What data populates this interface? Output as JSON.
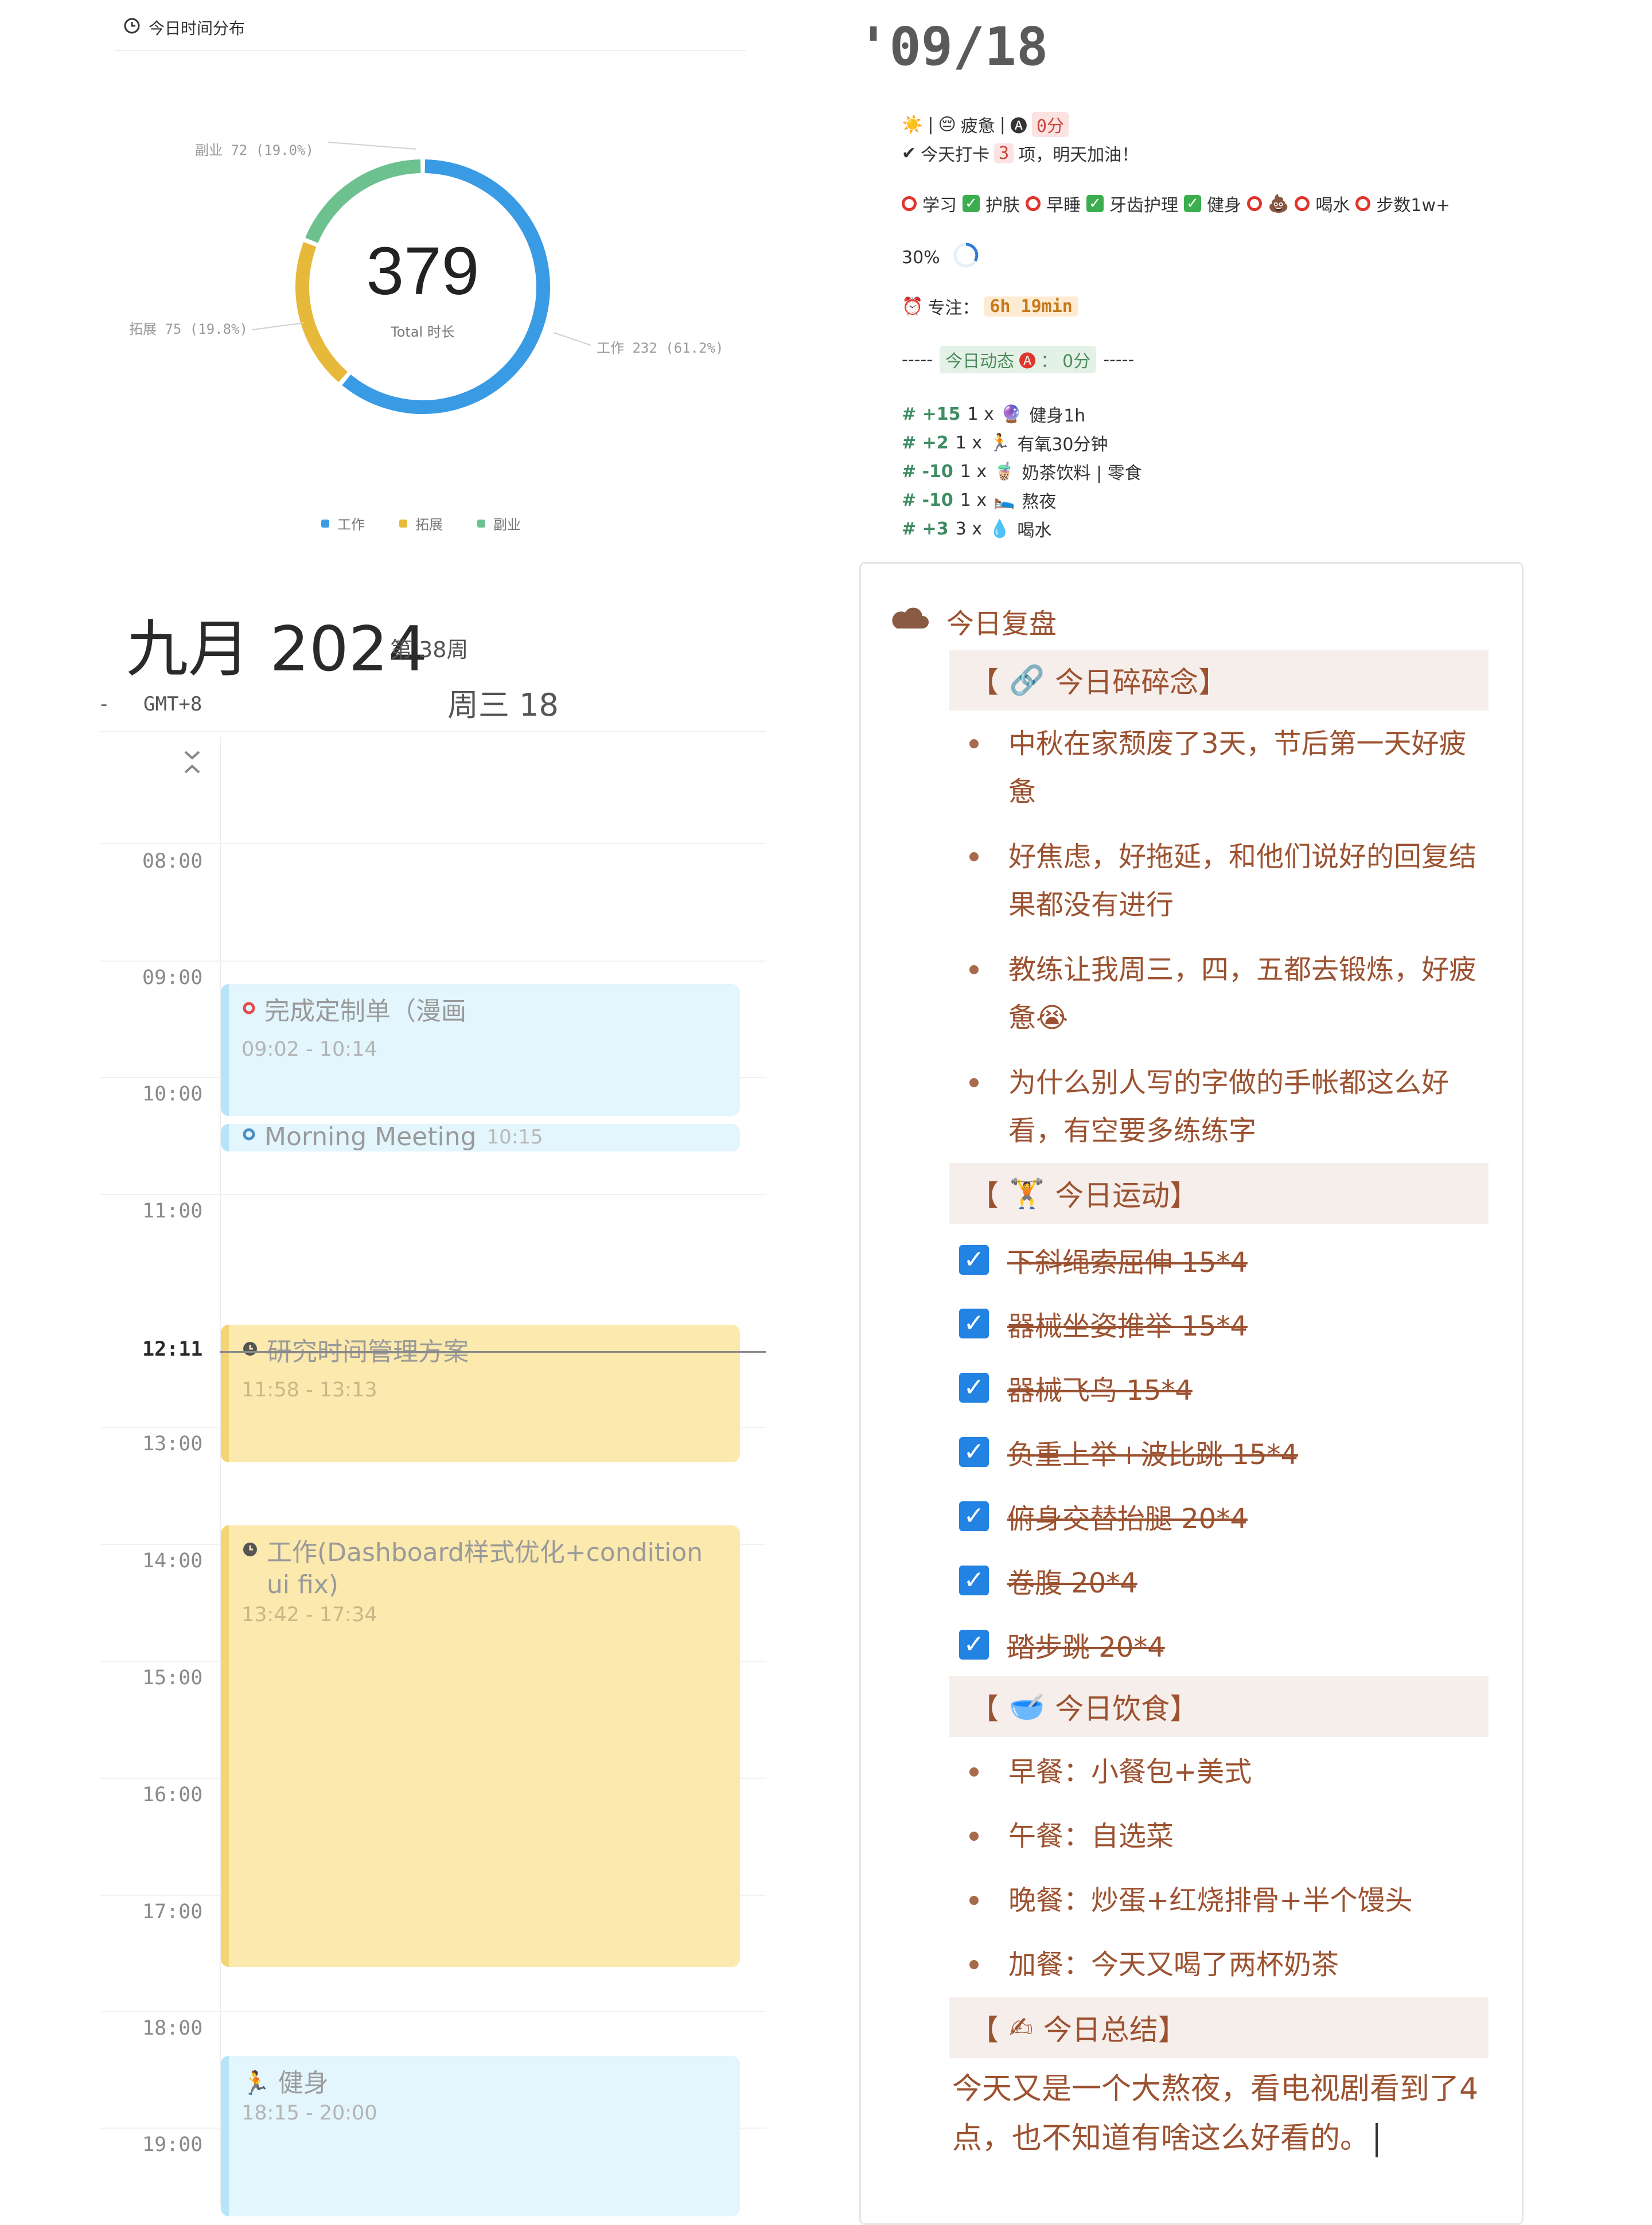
{
  "donut": {
    "title": "今日时间分布",
    "total": "379",
    "total_label": "Total 时长",
    "label_side": "副业  72  (19.0%)",
    "label_expand": "拓展  75  (19.8%)",
    "label_work": "工作  232  (61.2%)",
    "legend": [
      {
        "label": "工作",
        "color": "#3a9be5"
      },
      {
        "label": "拓展",
        "color": "#e7b93a"
      },
      {
        "label": "副业",
        "color": "#6cc18f"
      }
    ]
  },
  "chart_data": {
    "type": "pie",
    "center_value": "379",
    "center_label": "Total 时长",
    "categories": [
      "工作",
      "拓展",
      "副业"
    ],
    "values": [
      232,
      75,
      72
    ],
    "percent": [
      61.2,
      19.8,
      19.0
    ],
    "colors": [
      "#3a9be5",
      "#e7b93a",
      "#6cc18f"
    ],
    "title": "今日时间分布",
    "legend_position": "bottom"
  },
  "calendar": {
    "month_title": "九月 2024",
    "week": "第 38周",
    "dash": "-",
    "timezone": "GMT+8",
    "day": "周三 18",
    "hours": [
      "08:00",
      "09:00",
      "10:00",
      "11:00",
      "12:11",
      "13:00",
      "14:00",
      "15:00",
      "16:00",
      "17:00",
      "18:00",
      "19:00"
    ],
    "events": [
      {
        "title": "完成定制单（漫画",
        "time": "09:02 - 10:14"
      },
      {
        "title": "Morning Meeting",
        "tail": "10:15"
      },
      {
        "title": "研究时间管理方案",
        "time": "11:58 - 13:13"
      },
      {
        "title": "工作(Dashboard样式优化+condition ui fix)",
        "time": "13:42 - 17:34"
      },
      {
        "title": "健身",
        "time": "18:15 - 20:00"
      }
    ]
  },
  "status": {
    "date": "'09/18",
    "mood_sep": "|",
    "mood": "疲惫",
    "mood_sep2": "|",
    "mood_score": "0分",
    "checkin_prefix": "今天打卡",
    "checkin_count": "3",
    "checkin_suffix": "项，明天加油！",
    "habits": [
      {
        "label": "学习",
        "done": false
      },
      {
        "label": "护肤",
        "done": true
      },
      {
        "label": "早睡",
        "done": false
      },
      {
        "label": "牙齿护理",
        "done": true
      },
      {
        "label": "健身",
        "done": true
      },
      {
        "label": "",
        "done": false
      },
      {
        "label": "喝水",
        "done": false
      },
      {
        "label": "步数1w+",
        "done": false
      }
    ],
    "progress": "30%",
    "focus_label": "专注：",
    "focus_value": "6h 19min",
    "dyn_dashes_left": "-----",
    "dyn_label": "今日动态",
    "dyn_colon": "：",
    "dyn_score": "0分",
    "dyn_dashes_right": "-----",
    "scores": [
      {
        "hash": "# +15",
        "count": "1 x",
        "item": "健身1h",
        "emoji": "🔮"
      },
      {
        "hash": "# +2",
        "count": "1 x",
        "item": "有氧30分钟",
        "emoji": "🏃"
      },
      {
        "hash": "# -10",
        "count": "1 x",
        "item": "奶茶饮料 | 零食",
        "emoji": "🧋"
      },
      {
        "hash": "# -10",
        "count": "1 x",
        "item": "熬夜",
        "emoji": "🛌"
      },
      {
        "hash": "# +3",
        "count": "3 x",
        "item": "喝水",
        "emoji": "💧"
      }
    ]
  },
  "review": {
    "title": "今日复盘",
    "sec_thoughts": "今日碎碎念】",
    "sec_open": "【",
    "thoughts": [
      "中秋在家颓废了3天，节后第一天好疲惫",
      "好焦虑，好拖延，和他们说好的回复结果都没有进行",
      "教练让我周三，四，五都去锻炼，好疲惫😭",
      "为什么别人写的字做的手帐都这么好看，有空要多练练字"
    ],
    "sec_sport": "今日运动】",
    "sports": [
      "下斜绳索屈伸 15*4",
      "器械坐姿推举 15*4",
      "器械飞鸟 15*4",
      "负重上举+波比跳 15*4",
      "俯身交替抬腿 20*4",
      "卷腹 20*4",
      "踏步跳 20*4"
    ],
    "sec_food": "今日饮食】",
    "foods": [
      "早餐：小餐包+美式",
      "午餐：自选菜",
      "晚餐：炒蛋+红烧排骨+半个馒头",
      "加餐：今天又喝了两杯奶茶"
    ],
    "sec_summary": "今日总结】",
    "summary": "今天又是一个大熬夜，看电视剧看到了4点，也不知道有啥这么好看的。"
  }
}
